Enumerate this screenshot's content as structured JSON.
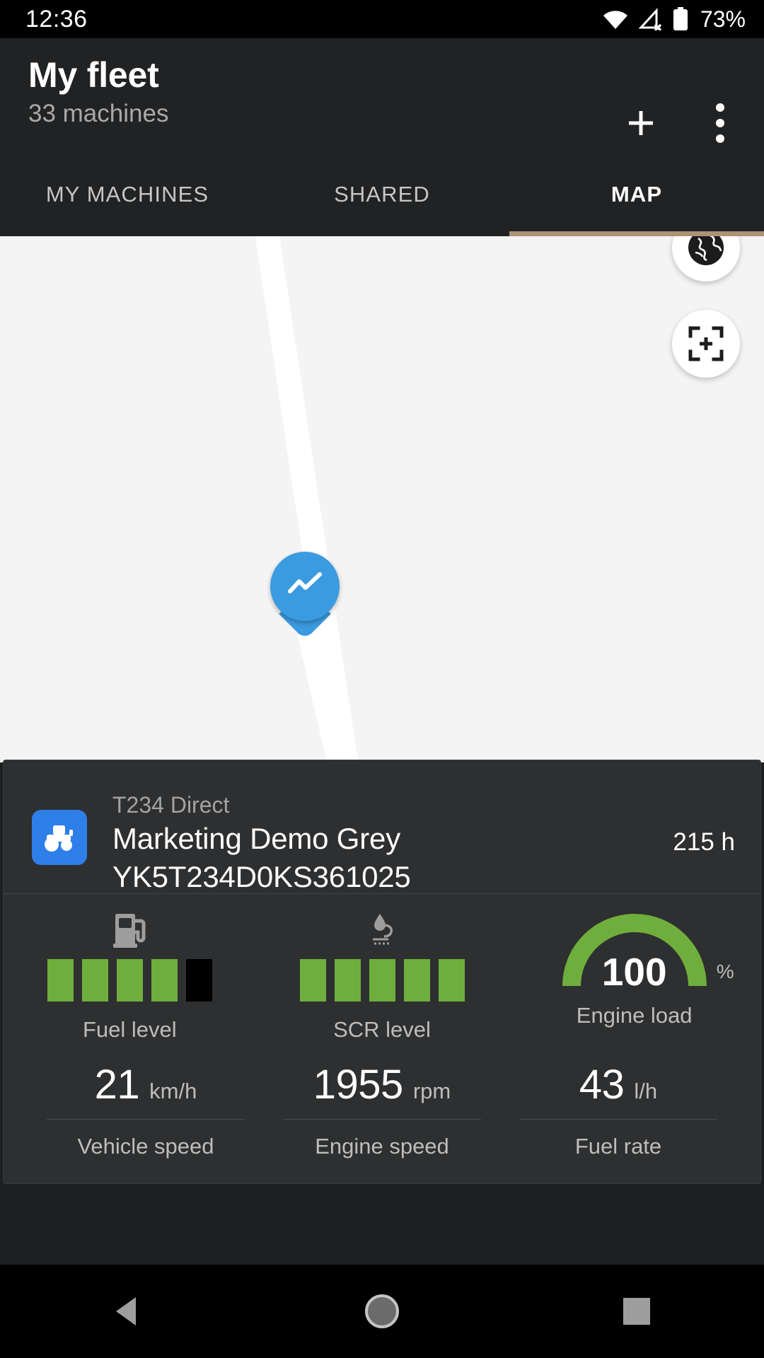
{
  "status_bar": {
    "time": "12:36",
    "battery_percent": "73%",
    "icons": [
      "wifi-icon",
      "cellular-off-icon",
      "battery-icon"
    ]
  },
  "header": {
    "title": "My fleet",
    "subtitle": "33 machines",
    "add_label": "+",
    "overflow_label": "⋮"
  },
  "tabs": [
    {
      "label": "MY MACHINES",
      "active": false
    },
    {
      "label": "SHARED",
      "active": false
    },
    {
      "label": "MAP",
      "active": true
    }
  ],
  "map": {
    "controls": [
      {
        "name": "map-type-globe-button",
        "icon": "globe-icon"
      },
      {
        "name": "map-focus-button",
        "icon": "crosshair-focus-icon"
      }
    ],
    "marker": {
      "icon": "activity-chart-icon",
      "color": "#3b9be0"
    },
    "background_color": "#f4f4f4",
    "road_color": "#ffffff"
  },
  "machine_card": {
    "icon": "tractor-icon",
    "icon_color": "#2f7fe8",
    "model": "T234 Direct",
    "name": "Marketing Demo Grey",
    "serial": "YK5T234D0KS361025",
    "hours": "215 h"
  },
  "gauges": [
    {
      "name": "fuel-level",
      "icon": "fuel-pump-icon",
      "label": "Fuel level",
      "segments_total": 5,
      "segments_filled": 4,
      "fill_color": "#6fae3c",
      "empty_color": "#000000"
    },
    {
      "name": "scr-level",
      "icon": "scr-fluid-icon",
      "label": "SCR level",
      "segments_total": 5,
      "segments_filled": 5,
      "fill_color": "#6fae3c",
      "empty_color": "#000000"
    },
    {
      "name": "engine-load",
      "icon": "arc-gauge-icon",
      "label": "Engine load",
      "value": "100",
      "unit": "%",
      "percent": 100,
      "fill_color": "#6fae3c"
    }
  ],
  "metrics": [
    {
      "name": "vehicle-speed",
      "value": "21",
      "unit": "km/h",
      "label": "Vehicle speed"
    },
    {
      "name": "engine-speed",
      "value": "1955",
      "unit": "rpm",
      "label": "Engine speed"
    },
    {
      "name": "fuel-rate",
      "value": "43",
      "unit": "l/h",
      "label": "Fuel rate"
    }
  ],
  "nav_bar": {
    "back": "back-triangle-icon",
    "home": "home-circle-icon",
    "recents": "recents-square-icon"
  },
  "colors": {
    "accent_tab": "#ad9276",
    "marker_blue": "#3b9be0",
    "gauge_green": "#6fae3c",
    "card_bg": "#2e2f30",
    "appbar_bg": "#212223"
  }
}
